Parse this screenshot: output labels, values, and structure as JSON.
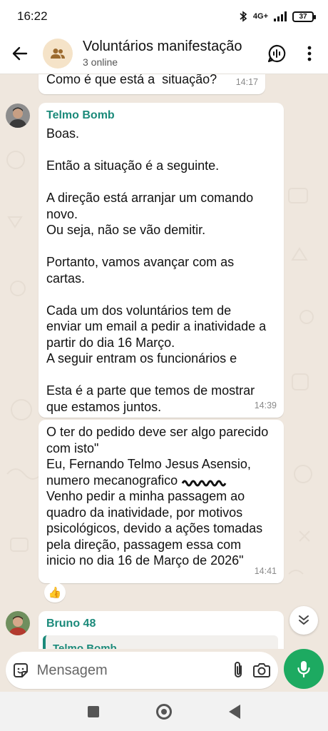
{
  "status_bar": {
    "time": "16:22",
    "network": "4G+",
    "battery": "37"
  },
  "header": {
    "title": "Voluntários manifestação",
    "subtitle": "3 online"
  },
  "messages": [
    {
      "text": "Como é que está a  situação?",
      "time": "14:17"
    },
    {
      "sender": "Telmo Bomb",
      "text": "Boas.\n\nEntão a situação é a seguinte.\n\nA direção está arranjar um comando\nnovo.\nOu seja, não se vão demitir.\n\nPortanto, vamos avançar com as\ncartas.\n\nCada um dos voluntários tem de\nenviar um email a pedir a inatividade a\npartir do dia 16 Março.\nA seguir entram os funcionários e\n\nEsta é a parte que temos de mostrar\nque estamos juntos.",
      "time": "14:39"
    },
    {
      "text": "O ter do pedido deve ser algo parecido\ncom isto\"\nEu, Fernando Telmo Jesus Asensio,\nnumero mecanografico",
      "text_tail": "Venho pedir a minha passagem ao\nquadro da inatividade, por motivos\npsicológicos, devido a ações tomadas\npela direção, passagem essa com\ninicio no dia 16 de Março de 2026\"",
      "time": "14:41",
      "reaction": "👍"
    },
    {
      "sender": "Bruno 48",
      "quoted_sender": "Telmo Bomb"
    }
  ],
  "composer": {
    "placeholder": "Mensagem"
  },
  "colors": {
    "sender_name": "#1b8a7a",
    "send_button": "#1daa61",
    "chat_bg": "#efe7de"
  }
}
